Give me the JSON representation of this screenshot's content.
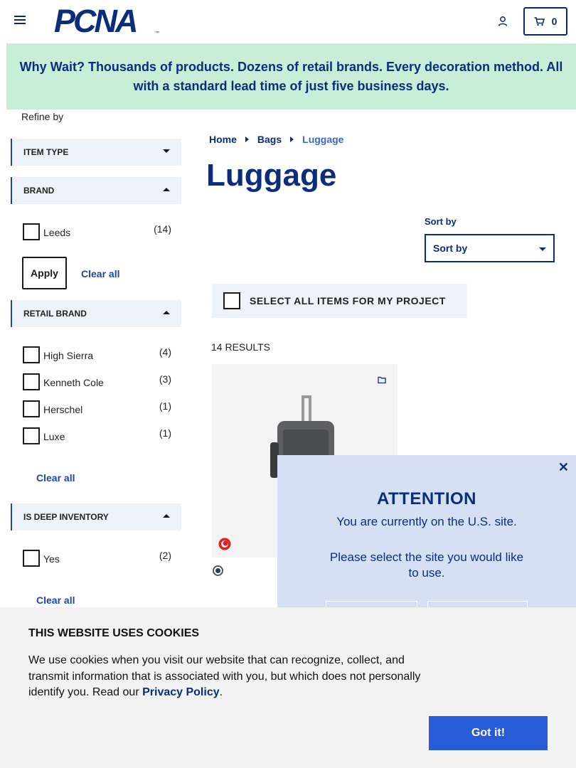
{
  "header": {
    "logo_text": "PCNA",
    "cart_count": "0"
  },
  "banner": {
    "text": "Why Wait? Thousands of products. Dozens of retail brands. Every decoration method. All with a standard lead time of just five business days."
  },
  "sidebar": {
    "refine_label": "Refine by",
    "facets": [
      {
        "title": "ITEM TYPE",
        "expanded": false
      },
      {
        "title": "BRAND",
        "expanded": true,
        "options": [
          {
            "label": "Leeds",
            "count": "(14)"
          }
        ]
      },
      {
        "title": "RETAIL BRAND",
        "expanded": true,
        "options": [
          {
            "label": "High Sierra",
            "count": "(4)"
          },
          {
            "label": "Kenneth Cole",
            "count": "(3)"
          },
          {
            "label": "Herschel",
            "count": "(1)"
          },
          {
            "label": "Luxe",
            "count": "(1)"
          }
        ]
      },
      {
        "title": "IS DEEP INVENTORY",
        "expanded": true,
        "options": [
          {
            "label": "Yes",
            "count": "(2)"
          }
        ]
      }
    ],
    "apply_label": "Apply",
    "clear_all_label": "Clear all"
  },
  "main": {
    "breadcrumb": [
      "Home",
      "Bags",
      "Luggage"
    ],
    "title": "Luggage",
    "sort_label": "Sort by",
    "sort_value": "Sort by",
    "select_all_label": "SELECT ALL ITEMS FOR MY PROJECT",
    "results_count": "14 RESULTS"
  },
  "modal": {
    "title": "ATTENTION",
    "line1": "You are currently on the U.S. site.",
    "line2": "Please select the site you would like to use."
  },
  "cookie": {
    "title": "THIS WEBSITE USES COOKIES",
    "text_before": "We use cookies when you visit our website that can recognize, collect, and transmit information that is associated with you, but which does not personally identify you. Read our ",
    "link": "Privacy Policy",
    "text_after": ".",
    "button": "Got it!"
  },
  "colors": {
    "brand_navy": "#0b2d7c",
    "banner_bg": "#c8eed7",
    "facet_bg": "#eef2fa",
    "modal_bg": "#d6e0f5",
    "button_blue": "#2a5bd7"
  }
}
